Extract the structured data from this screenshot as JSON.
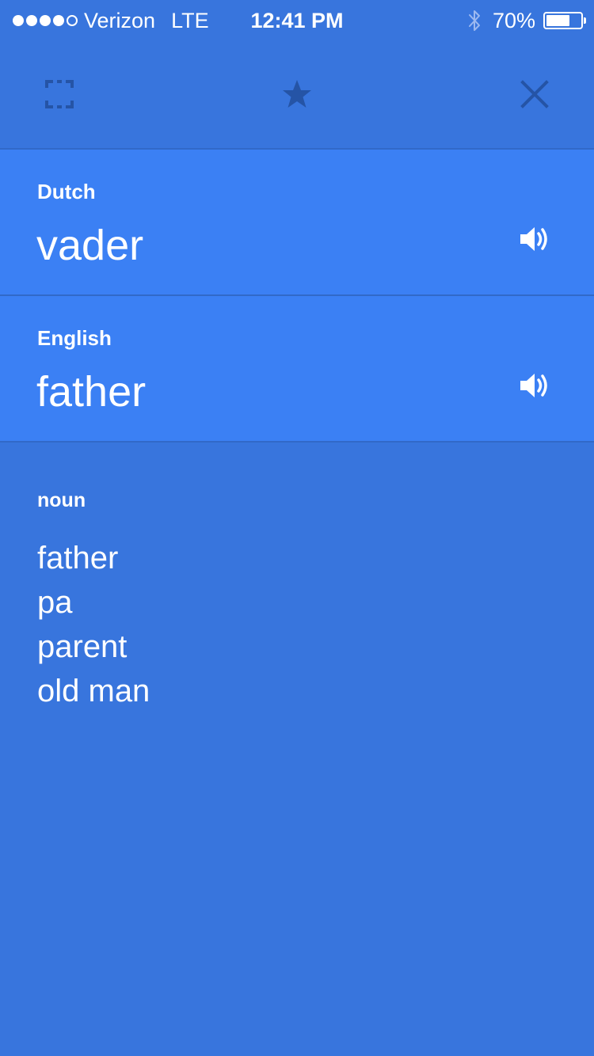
{
  "status_bar": {
    "signal_bars": 4,
    "signal_total": 5,
    "carrier": "Verizon",
    "network": "LTE",
    "time": "12:41 PM",
    "battery_percent": "70%",
    "battery_level": 0.7
  },
  "toolbar": {
    "fullscreen_icon": "fullscreen-icon",
    "star_icon": "star-icon",
    "close_icon": "close-icon"
  },
  "source": {
    "language": "Dutch",
    "text": "vader"
  },
  "target": {
    "language": "English",
    "text": "father"
  },
  "dictionary": {
    "part_of_speech": "noun",
    "entries": [
      "father",
      "pa",
      "parent",
      "old man"
    ]
  },
  "colors": {
    "background": "#3875DD",
    "panel": "#3B80F4",
    "toolbar_icon": "#2554A6"
  }
}
